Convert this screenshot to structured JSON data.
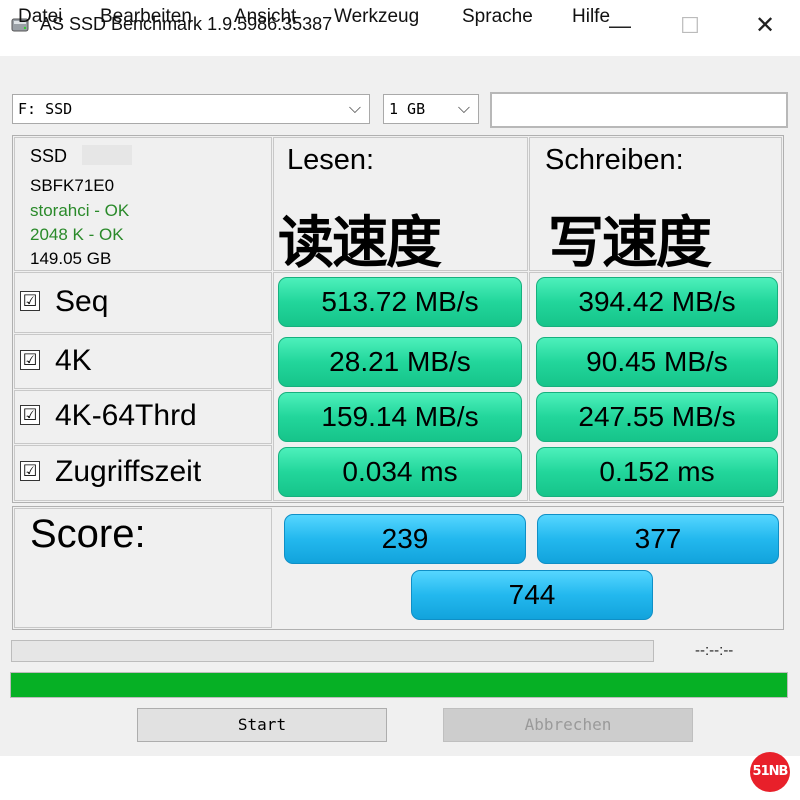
{
  "window": {
    "title": "AS SSD Benchmark 1.9.5986.35387"
  },
  "menu": [
    "Datei",
    "Bearbeiten",
    "Ansicht",
    "Werkzeug",
    "Sprache",
    "Hilfe"
  ],
  "drive_select": {
    "value": "F: SSD"
  },
  "size_select": {
    "value": "1 GB"
  },
  "drive_info": {
    "name": "SSD",
    "model": "SBFK71E0",
    "driver": "storahci - OK",
    "alignment": "2048 K - OK",
    "capacity": "149.05 GB"
  },
  "columns": {
    "read": "Lesen:",
    "write": "Schreiben:",
    "read_cn": "读速度",
    "write_cn": "写速度"
  },
  "rows": [
    {
      "label": "Seq",
      "checked": true,
      "read": "513.72 MB/s",
      "write": "394.42 MB/s"
    },
    {
      "label": "4K",
      "checked": true,
      "read": "28.21 MB/s",
      "write": "90.45 MB/s"
    },
    {
      "label": "4K-64Thrd",
      "checked": true,
      "read": "159.14 MB/s",
      "write": "247.55 MB/s"
    },
    {
      "label": "Zugriffszeit",
      "checked": true,
      "read": "0.034 ms",
      "write": "0.152 ms"
    }
  ],
  "score": {
    "label": "Score:",
    "read": "239",
    "write": "377",
    "total": "744"
  },
  "progress": {
    "time": "--:--:--",
    "fill_fraction": 1.0,
    "color": "#06b025"
  },
  "buttons": {
    "start": "Start",
    "abort": "Abbrechen"
  },
  "checkbox_mark": "☑",
  "watermark": "51NB",
  "colors": {
    "result_green": "#22d69b",
    "score_blue": "#23b8ee"
  }
}
